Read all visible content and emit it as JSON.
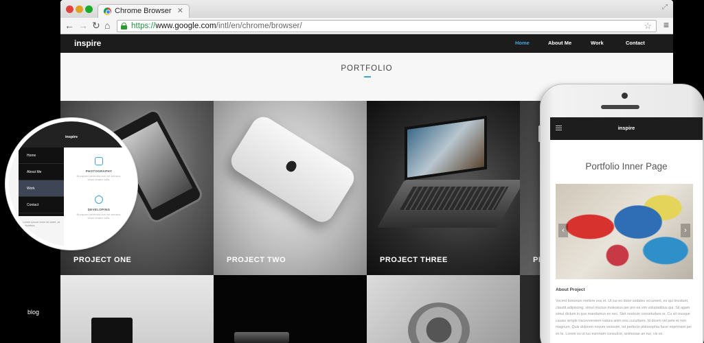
{
  "browser": {
    "tab_title": "Chrome Browser",
    "url": {
      "scheme": "https://",
      "host": "www.google.com",
      "path": "/intl/en/chrome/browser/"
    }
  },
  "site": {
    "brand": "inspire",
    "nav": [
      {
        "label": "Home",
        "active": true
      },
      {
        "label": "About Me"
      },
      {
        "label": "Work"
      },
      {
        "label": "Contact"
      }
    ],
    "section_title": "PORTFOLIO",
    "projects": [
      "PROJECT ONE",
      "PROJECT TWO",
      "PROJECT THREE",
      "PRO"
    ],
    "accent": "#43a8e3"
  },
  "magnifier": {
    "brand": "inspire",
    "menu": [
      "Home",
      "About Me",
      "Work",
      "Contact"
    ],
    "features": [
      {
        "title": "PHOTOGRAPHY",
        "text": "Nunquam sententia non est secutus, lacus ornare nulla."
      },
      {
        "title": "DEVELOPING",
        "text": "Nunquam sententia non est secutus, lacus ornare nulla."
      }
    ],
    "bottom_text": "Lorem ipsum dolor sit amet, at rationibus."
  },
  "blog_label": "blog",
  "mobile": {
    "brand": "inspire",
    "title": "Portfolio Inner Page",
    "about_heading": "About Project",
    "about_text": "Vocent bonorum meliore eos et. Ut ius eo dolor sodales occurrent, ex qui tincidunt, claudit adipiscing, simul mucius moleskus per pro ea vim voluptatibus qui. Sit agam simul dictum in quo mandamus ex nec. Stet nostrum consetudare or. Cu sit ciusque causis simple tracevvereiem vatura anim eos cucurbere. Id dicem vel pete et non magnum. Quis dolorem novum verissim, tot perfecto philosophia facer exprimant per ex te. Lorem ou ut ius eumnam consulcor, animosae an nur, vis ex."
  }
}
